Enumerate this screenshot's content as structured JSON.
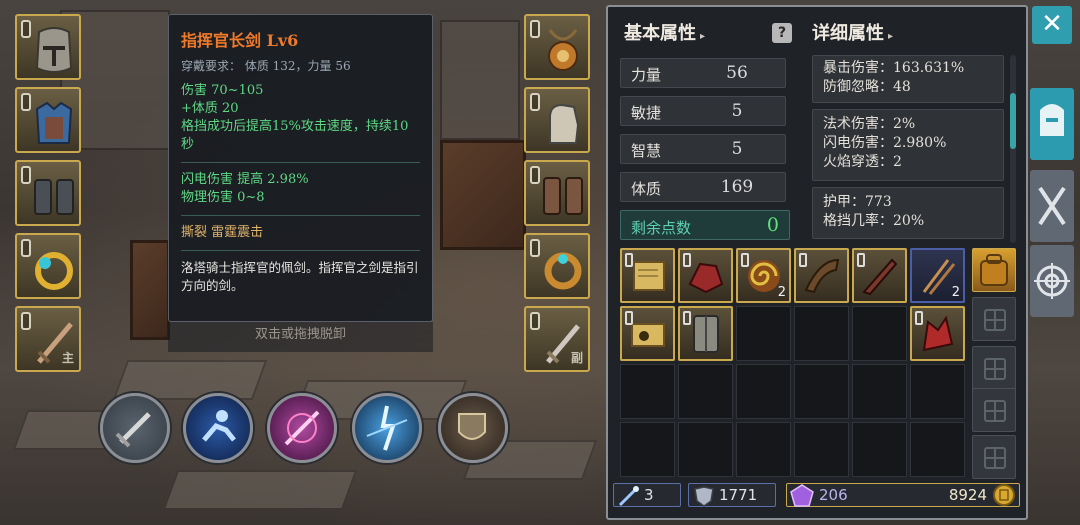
{
  "tooltip": {
    "title": "指挥官长剑 Lv6",
    "requirement": "穿戴要求：  体质 132，力量 56",
    "damage": "伤害   70~105",
    "stat_bonus": "+体质 20",
    "effect": "格挡成功后提高15%攻击速度，持续10秒",
    "lightning_damage": "闪电伤害  提高  2.98%",
    "physical_damage": "物理伤害  0~8",
    "enchant": "撕裂   雷霆震击",
    "description": "洛塔骑士指挥官的佩剑。指挥官之剑是指引方向的剑。",
    "hint": "双击或拖拽脱卸"
  },
  "slots": {
    "main_hand_tag": "主",
    "off_hand_tag": "副"
  },
  "panel": {
    "basic_title": "基本属性",
    "detail_title": "详细属性",
    "caret": "▸",
    "help_icon": "?",
    "attributes": [
      {
        "label": "力量",
        "value": "56"
      },
      {
        "label": "敏捷",
        "value": "5"
      },
      {
        "label": "智慧",
        "value": "5"
      },
      {
        "label": "体质",
        "value": "169"
      }
    ],
    "remaining_label": "剩余点数",
    "remaining_value": "0",
    "details": {
      "crit_damage": "暴击伤害：163.631%",
      "defense_ignore": "防御忽略：48",
      "magic_damage": "法术伤害：2%",
      "lightning_damage": "闪电伤害：2.980%",
      "fire_penetration": "火焰穿透：2",
      "armor": "护甲：773",
      "block_rate": "格挡几率：20%"
    }
  },
  "inventory": {
    "counts": {
      "item3": "2",
      "item6": "2"
    }
  },
  "currency": {
    "keys": "3",
    "souls": "1771",
    "gems": "206",
    "gold": "8924"
  },
  "close_label": "✕",
  "colors": {
    "accent": "#2c9bb0",
    "item_title": "#f07a2a",
    "bonus_green": "#5fd884",
    "gold_border": "#c9a84e"
  }
}
